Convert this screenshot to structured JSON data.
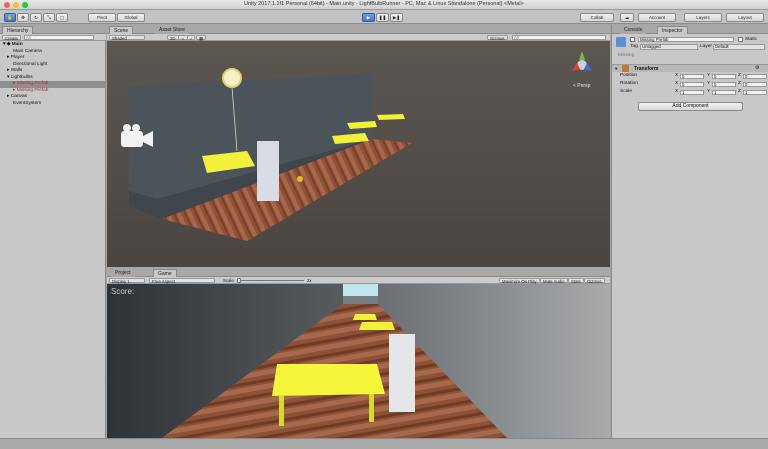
{
  "window": {
    "title": "Unity 2017.1.1f1 Personal (64bit) - Main.unity - LightBulbRunner - PC, Mac & Linux Standalone (Personal) <Metal>"
  },
  "toolbar": {
    "pivot": "Pivot",
    "global": "Global",
    "collab": "Collab",
    "account": "Account",
    "layers": "Layers",
    "layout": "Layout"
  },
  "hierarchy": {
    "tab": "Hierarchy",
    "create": "Create",
    "search_placeholder": "All",
    "items": [
      {
        "label": "Main"
      },
      {
        "label": "Main Camera"
      },
      {
        "label": "Player"
      },
      {
        "label": "Directional Light"
      },
      {
        "label": "Walls"
      },
      {
        "label": "Lightbulbs"
      },
      {
        "label": "Missing Prefab"
      },
      {
        "label": "Missing Prefab"
      },
      {
        "label": "Canvas"
      },
      {
        "label": "EventSystem"
      }
    ]
  },
  "scene": {
    "tab_scene": "Scene",
    "tab_asset_store": "Asset Store",
    "shading": "Shaded",
    "mode_2d": "2D",
    "gizmos": "Gizmos",
    "search_placeholder": "All",
    "persp": "< Persp"
  },
  "project": {
    "tab_project": "Project",
    "tab_game": "Game",
    "display": "Display 1",
    "aspect": "Free Aspect",
    "scale_label": "Scale",
    "scale_value": "2x",
    "maximize": "Maximize On Play",
    "mute": "Mute Audio",
    "stats": "Stats",
    "gizmos": "Gizmos",
    "score": "Score:"
  },
  "inspector": {
    "tab_console": "Console",
    "tab_inspector": "Inspector",
    "object_name": "Missing Prefab",
    "static": "Static",
    "tag_label": "Tag",
    "tag_value": "Untagged",
    "layer_label": "Layer",
    "layer_value": "Default",
    "missing": "Missing",
    "transform": "Transform",
    "position": {
      "label": "Position",
      "x": "0",
      "y": "0",
      "z": "0"
    },
    "rotation": {
      "label": "Rotation",
      "x": "0",
      "y": "0",
      "z": "0"
    },
    "scale": {
      "label": "Scale",
      "x": "1",
      "y": "1",
      "z": "1"
    },
    "add_component": "Add Component"
  },
  "colors": {
    "accent": "#3f78c4",
    "table": "#e8e830",
    "wall": "#4a5258",
    "sky": "#5a5550"
  }
}
